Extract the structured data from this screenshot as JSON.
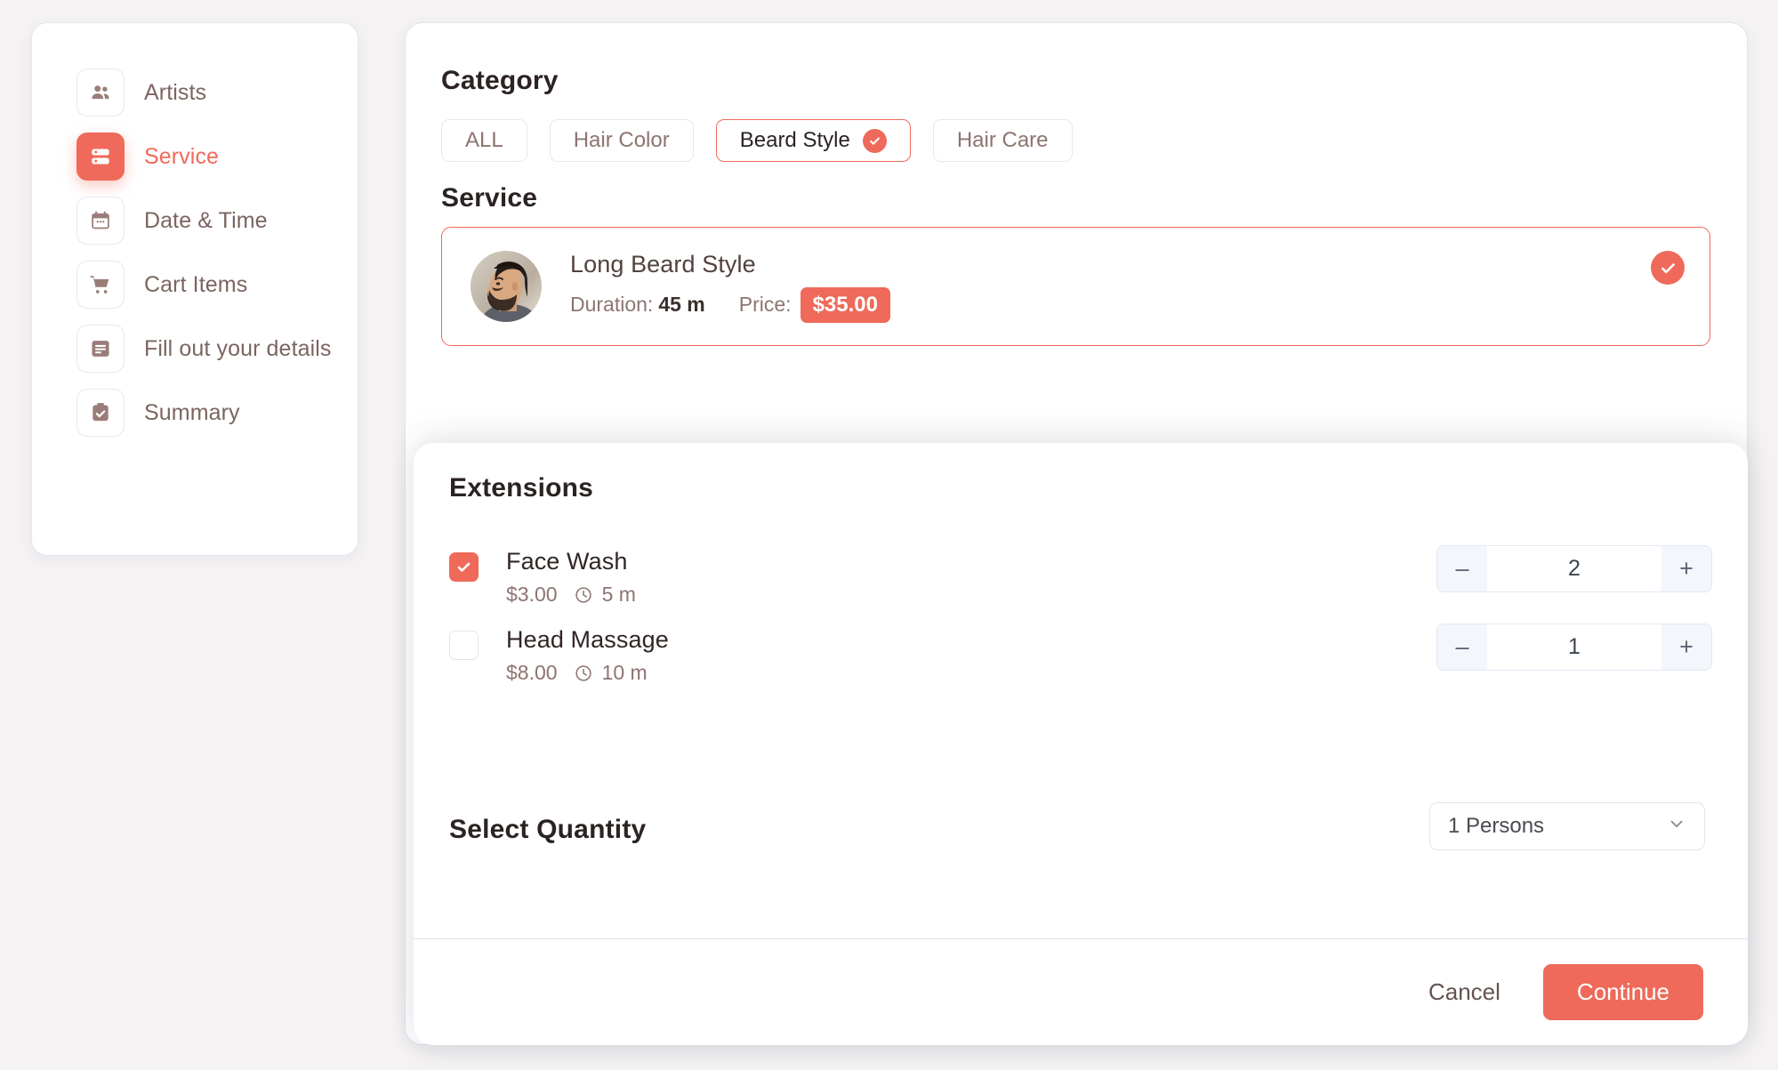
{
  "theme": {
    "accent": "#ef6a5a",
    "page_bg": "#f4f2f3",
    "card_bg": "#ffffff",
    "muted_text": "#8d7470",
    "heading_text": "#2b2322"
  },
  "sidebar": {
    "items": [
      {
        "label": "Artists",
        "icon": "people-icon",
        "active": false
      },
      {
        "label": "Service",
        "icon": "service-icon",
        "active": true
      },
      {
        "label": "Date & Time",
        "icon": "calendar-icon",
        "active": false
      },
      {
        "label": "Cart Items",
        "icon": "cart-icon",
        "active": false
      },
      {
        "label": "Fill out your details",
        "icon": "form-icon",
        "active": false
      },
      {
        "label": "Summary",
        "icon": "clipboard-check-icon",
        "active": false
      }
    ]
  },
  "category": {
    "title": "Category",
    "chips": [
      {
        "label": "ALL",
        "selected": false
      },
      {
        "label": "Hair Color",
        "selected": false
      },
      {
        "label": "Beard Style",
        "selected": true
      },
      {
        "label": "Hair Care",
        "selected": false
      }
    ]
  },
  "service": {
    "title": "Service",
    "selected_card": {
      "name": "Long Beard Style",
      "duration_label": "Duration:",
      "duration_value": "45 m",
      "price_label": "Price:",
      "price_value": "$35.00",
      "selected": true,
      "avatar_alt": "bearded-man-photo"
    }
  },
  "extensions": {
    "title": "Extensions",
    "items": [
      {
        "name": "Face Wash",
        "price": "$3.00",
        "duration": "5 m",
        "checked": true,
        "quantity": "2",
        "minus_label": "–",
        "plus_label": "+"
      },
      {
        "name": "Head Massage",
        "price": "$8.00",
        "duration": "10 m",
        "checked": false,
        "quantity": "1",
        "minus_label": "–",
        "plus_label": "+"
      }
    ],
    "quantity_section": {
      "label": "Select Quantity",
      "selected_option": "1 Persons"
    },
    "footer": {
      "cancel_label": "Cancel",
      "continue_label": "Continue"
    }
  }
}
